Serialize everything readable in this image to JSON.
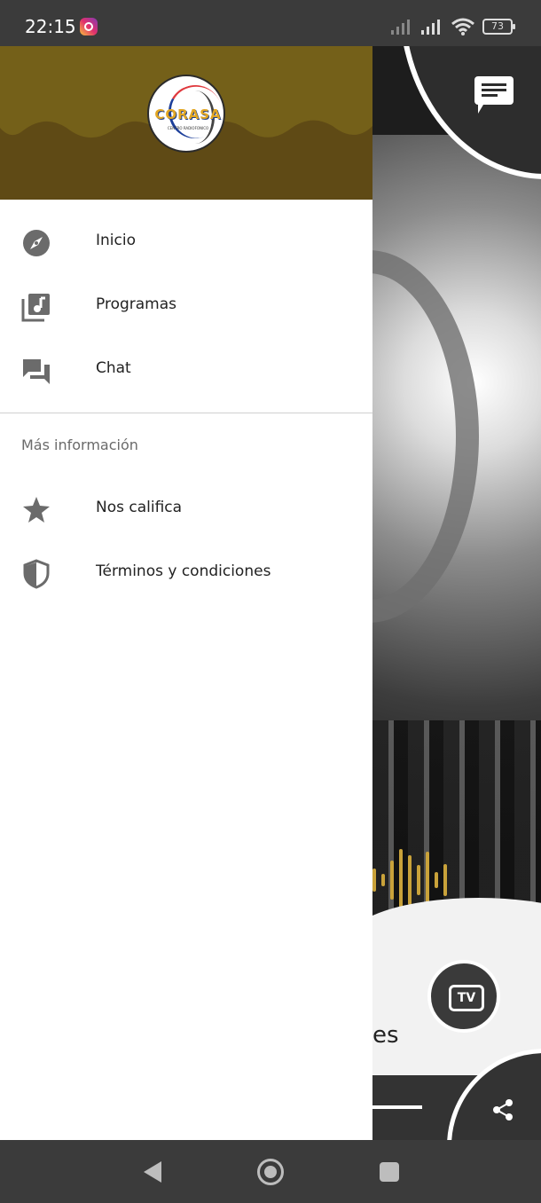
{
  "status_bar": {
    "time": "22:15",
    "battery": "73",
    "icons": [
      "instagram-icon",
      "signal-icon",
      "signal-icon",
      "wifi-icon",
      "battery-icon"
    ]
  },
  "drawer": {
    "header_color": "#68531a",
    "logo_text": "CORASA",
    "logo_subtext": "CENTRO RADIOFONICO",
    "items": [
      {
        "label": "Inicio",
        "icon": "compass-icon"
      },
      {
        "label": "Programas",
        "icon": "music-library-icon"
      },
      {
        "label": "Chat",
        "icon": "forum-icon"
      }
    ],
    "section_title": "Más información",
    "more_items": [
      {
        "label": "Nos califica",
        "icon": "star-icon"
      },
      {
        "label": "Términos y condiciones",
        "icon": "shield-icon"
      }
    ]
  },
  "background_app": {
    "visible_text": "es",
    "tv_label": "TV",
    "icons": [
      "chat-icon",
      "tv-icon",
      "share-icon"
    ]
  },
  "nav_bar": {
    "icons": [
      "back-icon",
      "home-icon",
      "recent-apps-icon"
    ]
  }
}
